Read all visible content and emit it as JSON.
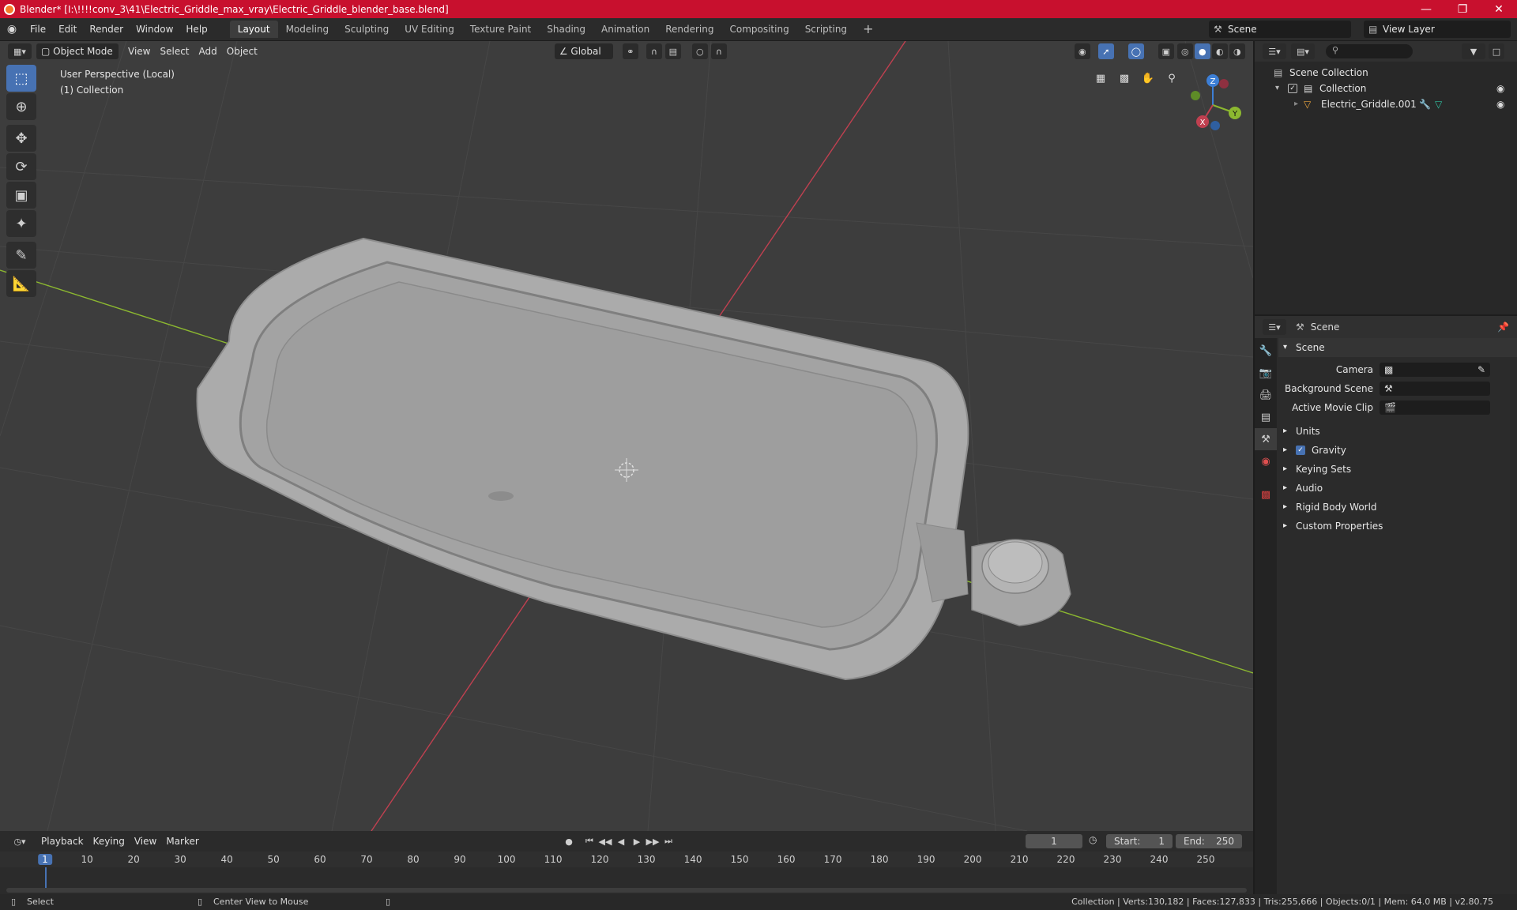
{
  "window": {
    "title": "Blender* [I:\\!!!!conv_3\\41\\Electric_Griddle_max_vray\\Electric_Griddle_blender_base.blend]"
  },
  "menu": {
    "items": [
      "File",
      "Edit",
      "Render",
      "Window",
      "Help"
    ]
  },
  "workspaces": [
    "Layout",
    "Modeling",
    "Sculpting",
    "UV Editing",
    "Texture Paint",
    "Shading",
    "Animation",
    "Rendering",
    "Compositing",
    "Scripting"
  ],
  "scene_selector": {
    "scene": "Scene",
    "view_layer": "View Layer"
  },
  "viewport": {
    "header": {
      "mode": "Object Mode",
      "menus": [
        "View",
        "Select",
        "Add",
        "Object"
      ],
      "orientation": "Global"
    },
    "info": {
      "line1": "User Perspective (Local)",
      "line2": "(1) Collection"
    },
    "gizmo": {
      "x": "X",
      "y": "Y",
      "z": "Z"
    }
  },
  "outliner": {
    "scene_collection": "Scene Collection",
    "collection": "Collection",
    "object": "Electric_Griddle.001"
  },
  "properties": {
    "header": "Scene",
    "panel": "Scene",
    "camera_label": "Camera",
    "background_scene_label": "Background Scene",
    "active_movie_clip_label": "Active Movie Clip",
    "sections": [
      "Units",
      "Gravity",
      "Keying Sets",
      "Audio",
      "Rigid Body World",
      "Custom Properties"
    ],
    "gravity_checked": true
  },
  "timeline": {
    "menus": [
      "Playback",
      "Keying",
      "View",
      "Marker"
    ],
    "current_frame": "1",
    "start_label": "Start:",
    "start": "1",
    "end_label": "End:",
    "end": "250",
    "ticks": [
      "1",
      "10",
      "20",
      "30",
      "40",
      "50",
      "60",
      "70",
      "80",
      "90",
      "100",
      "110",
      "120",
      "130",
      "140",
      "150",
      "160",
      "170",
      "180",
      "190",
      "200",
      "210",
      "220",
      "230",
      "240",
      "250"
    ]
  },
  "statusbar": {
    "left1": "Select",
    "left2": "Center View to Mouse",
    "right": "Collection | Verts:130,182 | Faces:127,833 | Tris:255,666 | Objects:0/1 | Mem: 64.0 MB | v2.80.75"
  },
  "colors": {
    "titlebar": "#c8102e",
    "accent": "#4772b3",
    "axis_x": "#c04050",
    "axis_y": "#8cb830",
    "axis_z": "#3d7fd6"
  }
}
